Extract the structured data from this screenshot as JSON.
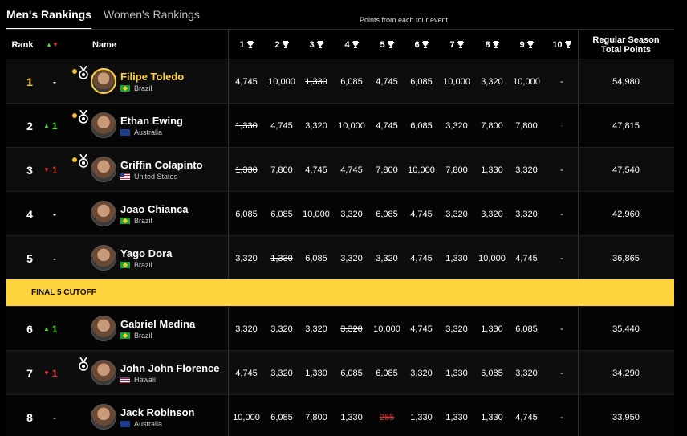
{
  "tabs": {
    "men": "Men's Rankings",
    "women": "Women's Rankings"
  },
  "points_caption": "Points from each tour event",
  "headers": {
    "rank": "Rank",
    "move": "▲▼",
    "name": "Name",
    "total_line1": "Regular Season",
    "total_line2": "Total Points"
  },
  "events": [
    "1",
    "2",
    "3",
    "4",
    "5",
    "6",
    "7",
    "8",
    "9",
    "10"
  ],
  "cutoff_label": "FINAL 5 CUTOFF",
  "rows": [
    {
      "rank": "1",
      "move": "-",
      "move_dir": "none",
      "name": "Filipe Toledo",
      "country": "Brazil",
      "flag": "br",
      "dot": true,
      "medal": true,
      "leader": true,
      "points": [
        "4,745",
        "10,000",
        "1,330",
        "6,085",
        "4,745",
        "6,085",
        "10,000",
        "3,320",
        "10,000",
        "-"
      ],
      "struck": [
        2
      ],
      "struck_red": [],
      "total": "54,980"
    },
    {
      "rank": "2",
      "move": "1",
      "move_dir": "up",
      "name": "Ethan Ewing",
      "country": "Australia",
      "flag": "au",
      "dot": true,
      "medal": true,
      "leader": false,
      "points": [
        "1,330",
        "4,745",
        "3,320",
        "10,000",
        "4,745",
        "6,085",
        "3,320",
        "7,800",
        "7,800",
        "-"
      ],
      "struck": [
        0
      ],
      "struck_red": [],
      "total": "47,815",
      "red_dash": true
    },
    {
      "rank": "3",
      "move": "1",
      "move_dir": "down",
      "name": "Griffin Colapinto",
      "country": "United States",
      "flag": "us",
      "dot": true,
      "medal": true,
      "leader": false,
      "points": [
        "1,330",
        "7,800",
        "4,745",
        "4,745",
        "7,800",
        "10,000",
        "7,800",
        "1,330",
        "3,320",
        "-"
      ],
      "struck": [
        0
      ],
      "struck_red": [],
      "total": "47,540"
    },
    {
      "rank": "4",
      "move": "-",
      "move_dir": "none",
      "name": "Joao Chianca",
      "country": "Brazil",
      "flag": "br",
      "dot": false,
      "medal": false,
      "leader": false,
      "points": [
        "6,085",
        "6,085",
        "10,000",
        "3,320",
        "6,085",
        "4,745",
        "3,320",
        "3,320",
        "3,320",
        "-"
      ],
      "struck": [
        3
      ],
      "struck_red": [],
      "total": "42,960"
    },
    {
      "rank": "5",
      "move": "-",
      "move_dir": "none",
      "name": "Yago Dora",
      "country": "Brazil",
      "flag": "br",
      "dot": false,
      "medal": false,
      "leader": false,
      "points": [
        "3,320",
        "1,330",
        "6,085",
        "3,320",
        "3,320",
        "4,745",
        "1,330",
        "10,000",
        "4,745",
        "-"
      ],
      "struck": [
        1
      ],
      "struck_red": [],
      "total": "36,865"
    },
    {
      "rank": "6",
      "move": "1",
      "move_dir": "up",
      "name": "Gabriel Medina",
      "country": "Brazil",
      "flag": "br",
      "dot": false,
      "medal": false,
      "leader": false,
      "points": [
        "3,320",
        "3,320",
        "3,320",
        "3,320",
        "10,000",
        "4,745",
        "3,320",
        "1,330",
        "6,085",
        "-"
      ],
      "struck": [
        3
      ],
      "struck_red": [],
      "total": "35,440"
    },
    {
      "rank": "7",
      "move": "1",
      "move_dir": "down",
      "name": "John John Florence",
      "country": "Hawaii",
      "flag": "hi",
      "dot": false,
      "medal": true,
      "leader": false,
      "points": [
        "4,745",
        "3,320",
        "1,330",
        "6,085",
        "6,085",
        "3,320",
        "1,330",
        "6,085",
        "3,320",
        "-"
      ],
      "struck": [
        2
      ],
      "struck_red": [],
      "total": "34,290"
    },
    {
      "rank": "8",
      "move": "-",
      "move_dir": "none",
      "name": "Jack Robinson",
      "country": "Australia",
      "flag": "au",
      "dot": false,
      "medal": false,
      "leader": false,
      "points": [
        "10,000",
        "6,085",
        "7,800",
        "1,330",
        "265",
        "1,330",
        "1,330",
        "1,330",
        "4,745",
        "-"
      ],
      "struck": [],
      "struck_red": [
        4
      ],
      "total": "33,950"
    }
  ]
}
